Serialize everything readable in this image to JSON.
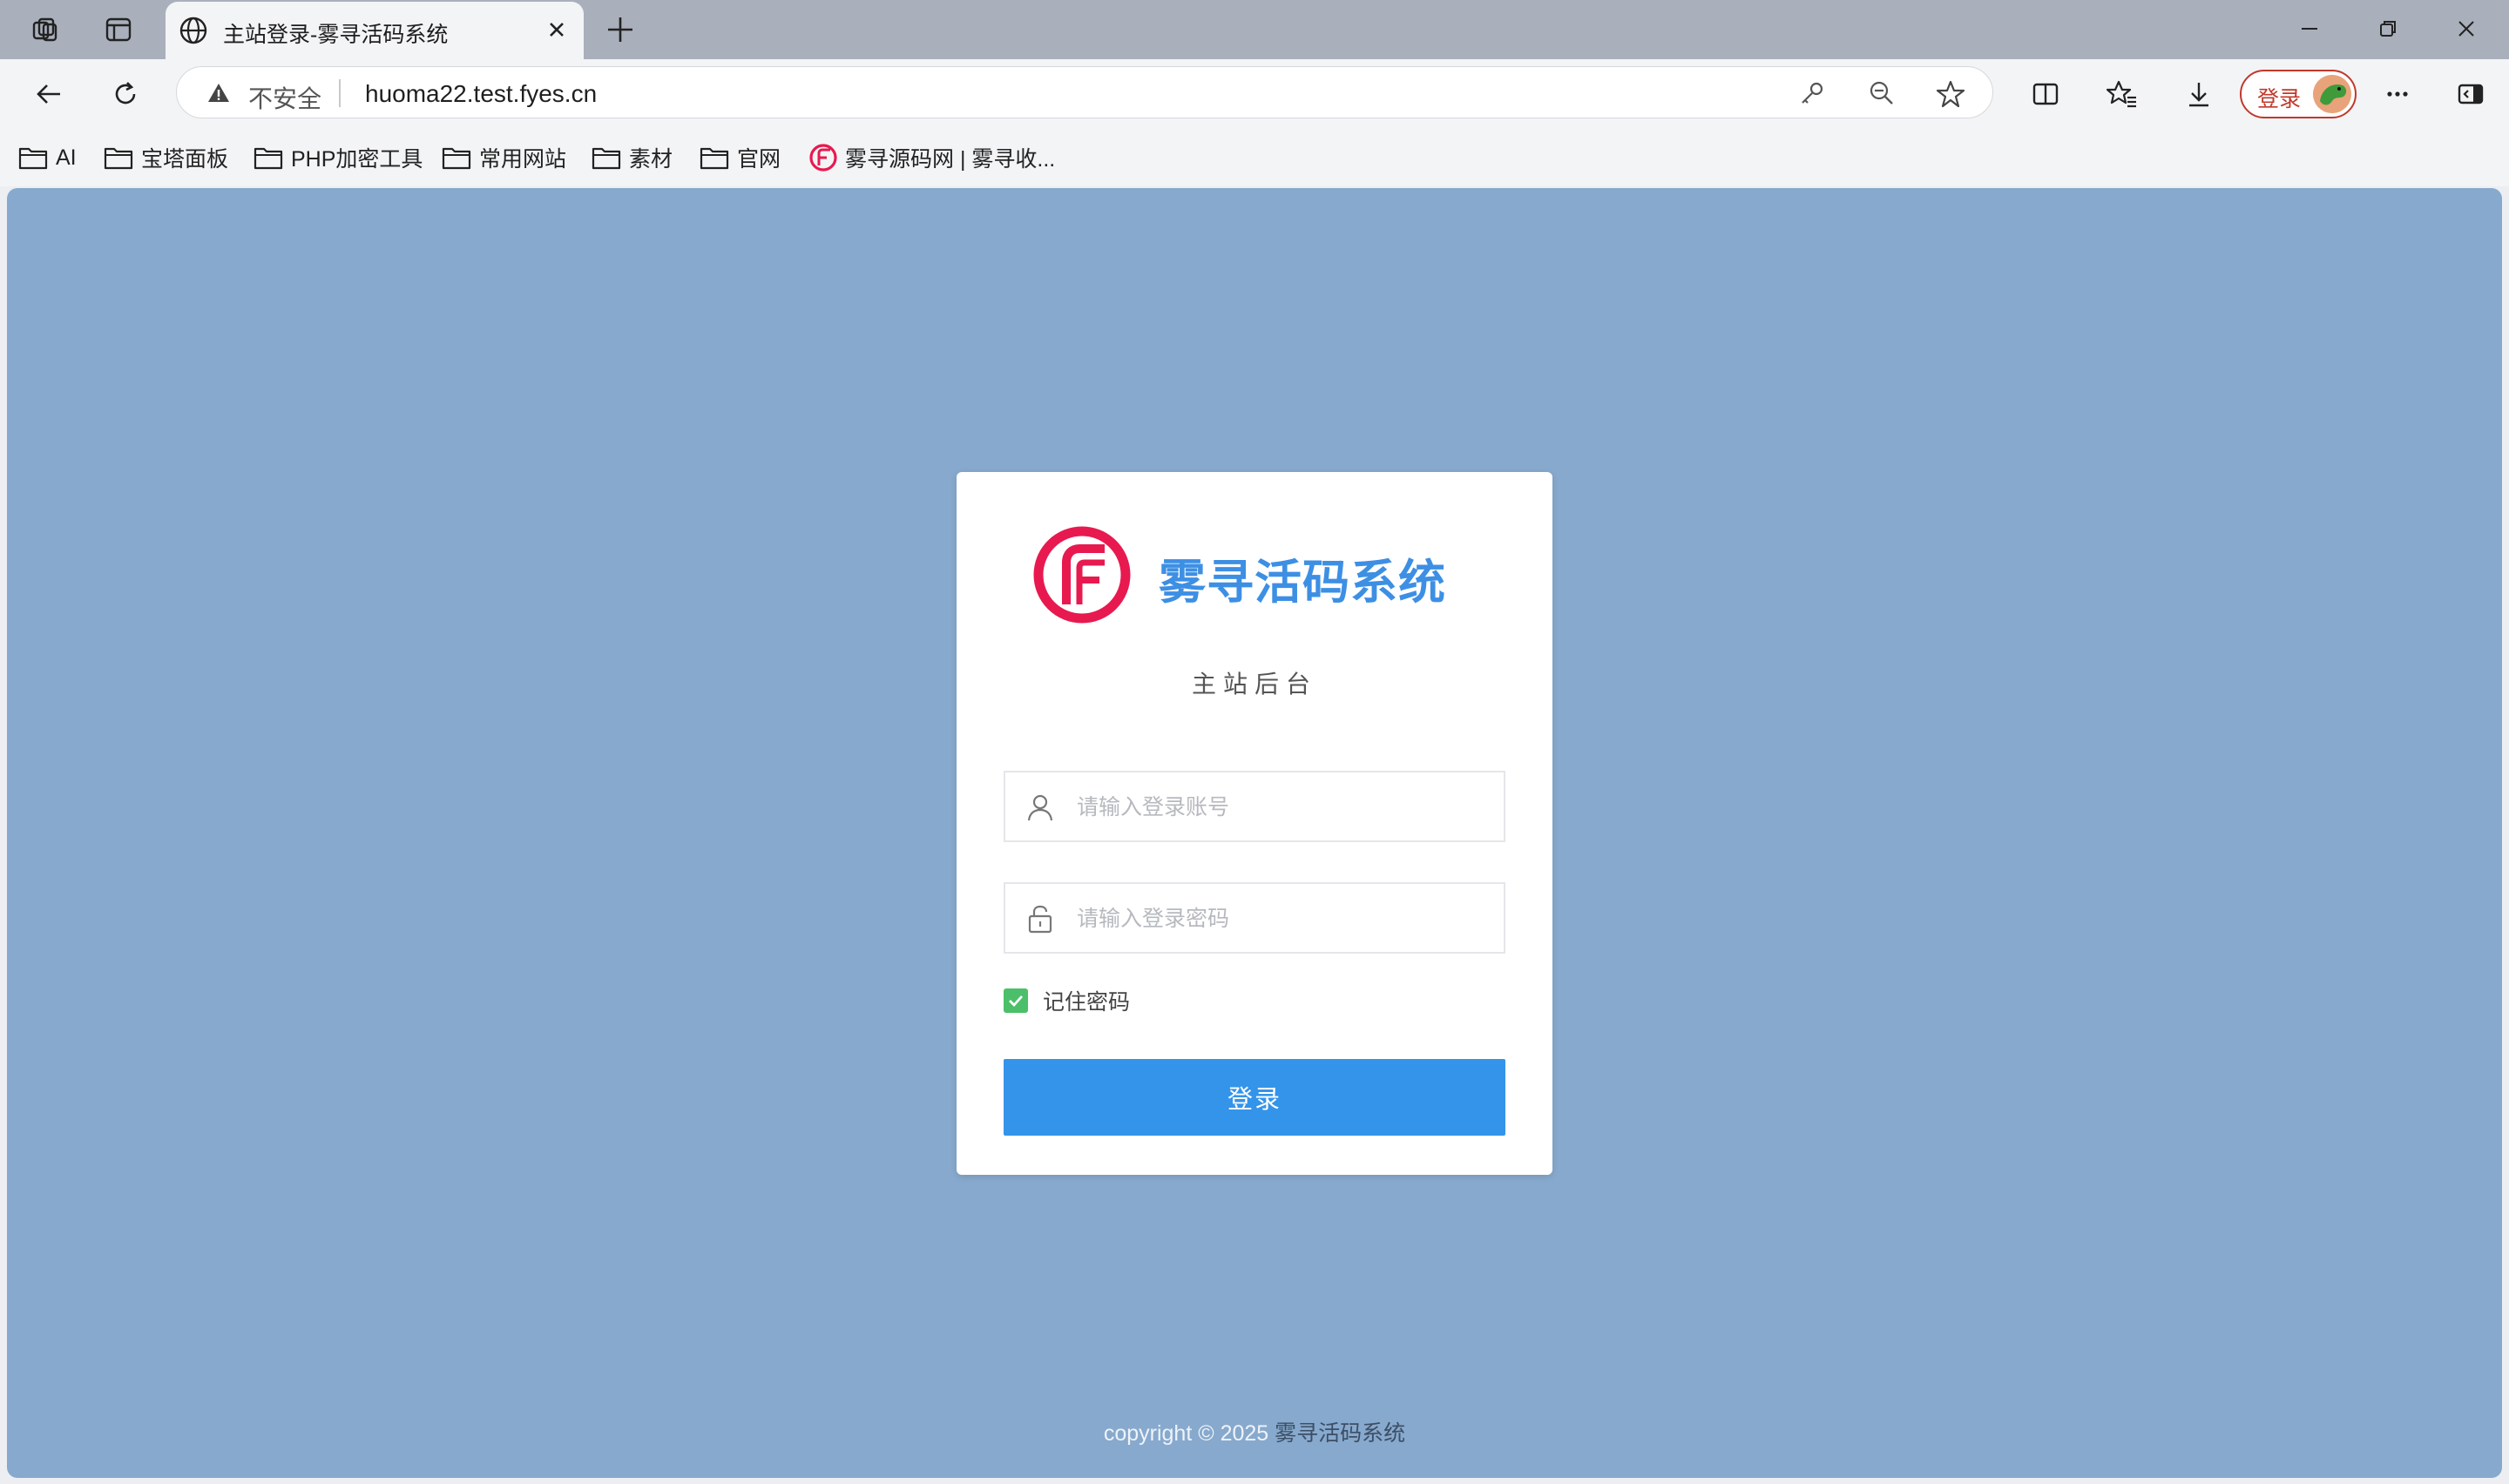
{
  "browser": {
    "tab": {
      "title": "主站登录-雾寻活码系统"
    },
    "address": {
      "security_label": "不安全",
      "url": "huoma22.test.fyes.cn"
    },
    "profile": {
      "label": "登录"
    }
  },
  "bookmarks": [
    {
      "label": "AI",
      "icon": "folder-icon"
    },
    {
      "label": "宝塔面板",
      "icon": "folder-icon"
    },
    {
      "label": "PHP加密工具",
      "icon": "folder-icon"
    },
    {
      "label": "常用网站",
      "icon": "folder-icon"
    },
    {
      "label": "素材",
      "icon": "folder-icon"
    },
    {
      "label": "官网",
      "icon": "folder-icon"
    },
    {
      "label": "雾寻源码网 | 雾寻收...",
      "icon": "site-favicon-icon"
    }
  ],
  "login": {
    "brand_name": "雾寻活码系统",
    "subtitle": "主站后台",
    "username_placeholder": "请输入登录账号",
    "password_placeholder": "请输入登录密码",
    "remember_label": "记住密码",
    "remember_checked": true,
    "submit_label": "登录"
  },
  "footer": {
    "copyright": "copyright © 2025",
    "brand": "雾寻活码系统"
  },
  "colors": {
    "page_background": "#87a9cd",
    "brand_blue": "#3d8fe4",
    "button_blue": "#3494ea",
    "logo_red": "#e8194f",
    "checkbox_green": "#4cbf6b"
  }
}
